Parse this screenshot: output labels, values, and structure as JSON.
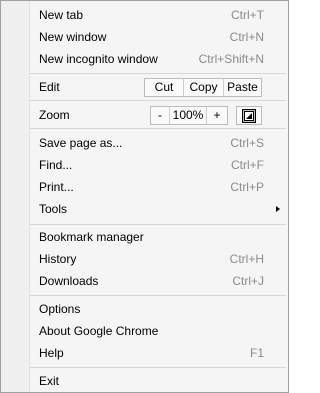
{
  "menu": {
    "new_tab": {
      "label": "New tab",
      "shortcut": "Ctrl+T"
    },
    "new_window": {
      "label": "New window",
      "shortcut": "Ctrl+N"
    },
    "new_incognito": {
      "label": "New incognito window",
      "shortcut": "Ctrl+Shift+N"
    },
    "edit": {
      "label": "Edit",
      "cut": "Cut",
      "copy": "Copy",
      "paste": "Paste"
    },
    "zoom": {
      "label": "Zoom",
      "minus": "-",
      "value": "100%",
      "plus": "+",
      "fullscreen_icon": "fullscreen-icon"
    },
    "save_page": {
      "label": "Save page as...",
      "shortcut": "Ctrl+S"
    },
    "find": {
      "label": "Find...",
      "shortcut": "Ctrl+F"
    },
    "print": {
      "label": "Print...",
      "shortcut": "Ctrl+P"
    },
    "tools": {
      "label": "Tools",
      "icon": "submenu-arrow-icon"
    },
    "bookmark_manager": {
      "label": "Bookmark manager"
    },
    "history": {
      "label": "History",
      "shortcut": "Ctrl+H"
    },
    "downloads": {
      "label": "Downloads",
      "shortcut": "Ctrl+J"
    },
    "options": {
      "label": "Options"
    },
    "about": {
      "label": "About Google Chrome"
    },
    "help": {
      "label": "Help",
      "shortcut": "F1"
    },
    "exit": {
      "label": "Exit"
    }
  }
}
